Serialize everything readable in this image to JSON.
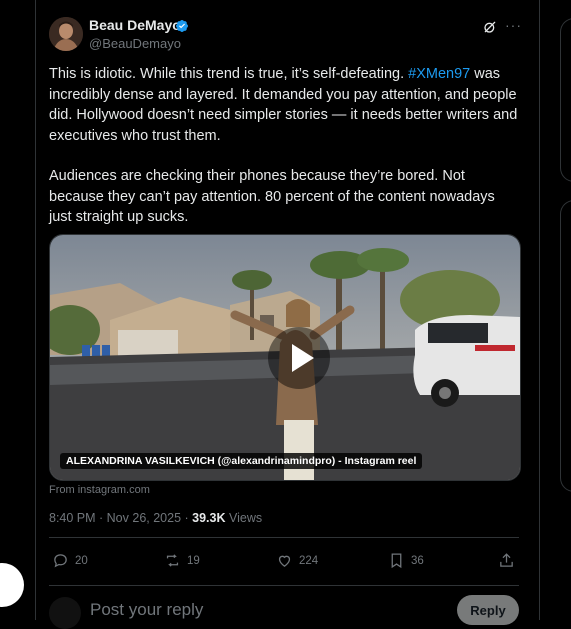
{
  "author": {
    "name": "Beau DeMayo",
    "handle": "@BeauDemayo",
    "verified_color": "#1d9bf0"
  },
  "icons": {
    "grok": "grok-icon",
    "more": "more-icon"
  },
  "tweet": {
    "p1_before": "This is idiotic. While this trend is true, it’s self-defeating. ",
    "p1_tag": "#XMen97",
    "p1_after": " was incredibly dense and layered. It demanded you pay attention, and people did. Hollywood doesn’t need simpler stories — it needs better writers and executives who trust them.",
    "p2": "Audiences are checking their phones because they’re bored. Not because they can’t pay attention. 80 percent of the content nowadays just straight up sucks."
  },
  "media": {
    "caption": "ALEXANDRINA VASILKEVICH (@alexandrinamindpro) - Instagram reel",
    "source": "From instagram.com"
  },
  "meta": {
    "timestamp": "8:40 PM · Nov 26, 2025 · ",
    "views_count": "39.3K",
    "views_label": " Views"
  },
  "actions": {
    "replies": "20",
    "reposts": "19",
    "likes": "224",
    "bookmarks": "36"
  },
  "reply_box": {
    "placeholder": "Post your reply",
    "button": "Reply"
  }
}
